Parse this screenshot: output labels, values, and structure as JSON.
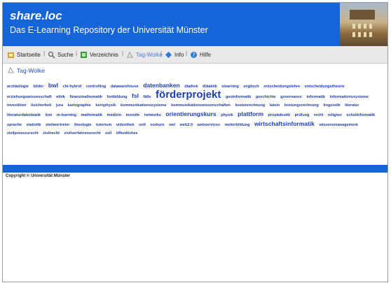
{
  "header": {
    "brand": "share.loc",
    "subtitle": "Das E-Learning Repository der Universität Münster"
  },
  "nav": {
    "items": [
      {
        "label": "Startseite",
        "icon": "home-icon"
      },
      {
        "label": "Suche",
        "icon": "search-icon"
      },
      {
        "label": "Verzeichnis",
        "icon": "directory-icon"
      },
      {
        "label": "Tag-Wolke",
        "icon": "tag-cloud-icon"
      },
      {
        "label": "Info",
        "icon": "info-icon"
      },
      {
        "label": "Hilfe",
        "icon": "help-icon"
      }
    ],
    "separator": "|"
  },
  "breadcrumb": {
    "label": "Tag-Wolke"
  },
  "tags": [
    {
      "label": "archäologie",
      "size": 1
    },
    {
      "label": "bilder",
      "size": 1
    },
    {
      "label": "bwl",
      "size": 3
    },
    {
      "label": "chi-hybrid",
      "size": 1
    },
    {
      "label": "controlling",
      "size": 1
    },
    {
      "label": "datawarehouse",
      "size": 1
    },
    {
      "label": "datenbanken",
      "size": 3
    },
    {
      "label": "diathek",
      "size": 1
    },
    {
      "label": "didaktik",
      "size": 1
    },
    {
      "label": "elearning",
      "size": 1
    },
    {
      "label": "englisch",
      "size": 1
    },
    {
      "label": "entscheidungslehre",
      "size": 1
    },
    {
      "label": "entscheidungstheorie",
      "size": 1
    },
    {
      "label": "erziehungswissenschaft",
      "size": 1
    },
    {
      "label": "ethik",
      "size": 1
    },
    {
      "label": "finanzmathematik",
      "size": 1
    },
    {
      "label": "fortbildung",
      "size": 1
    },
    {
      "label": "fsl",
      "size": 3
    },
    {
      "label": "fälle",
      "size": 1
    },
    {
      "label": "förderprojekt",
      "size": 5
    },
    {
      "label": "geoinformatik",
      "size": 1
    },
    {
      "label": "geschichte",
      "size": 1
    },
    {
      "label": "governance",
      "size": 1
    },
    {
      "label": "informatik",
      "size": 1
    },
    {
      "label": "informationssysteme",
      "size": 1
    },
    {
      "label": "investition",
      "size": 1
    },
    {
      "label": "itsicherheit",
      "size": 1
    },
    {
      "label": "jura",
      "size": 1
    },
    {
      "label": "kartographie",
      "size": 1
    },
    {
      "label": "kernphysik",
      "size": 1
    },
    {
      "label": "kommunikationssysteme",
      "size": 1
    },
    {
      "label": "kommunikationswissenschaften",
      "size": 1
    },
    {
      "label": "kostenrechnung",
      "size": 1
    },
    {
      "label": "latein",
      "size": 1
    },
    {
      "label": "leistungsrechnung",
      "size": 1
    },
    {
      "label": "linguistik",
      "size": 1
    },
    {
      "label": "literatur",
      "size": 1
    },
    {
      "label": "literaturdatenbank",
      "size": 1
    },
    {
      "label": "lom",
      "size": 1
    },
    {
      "label": "m-learning",
      "size": 1
    },
    {
      "label": "mathematik",
      "size": 1
    },
    {
      "label": "medizin",
      "size": 1
    },
    {
      "label": "moodle",
      "size": 1
    },
    {
      "label": "networks",
      "size": 1
    },
    {
      "label": "orientierungskurs",
      "size": 3
    },
    {
      "label": "physik",
      "size": 1
    },
    {
      "label": "plattform",
      "size": 3
    },
    {
      "label": "propädeutik",
      "size": 1
    },
    {
      "label": "prüfung",
      "size": 1
    },
    {
      "label": "recht",
      "size": 1
    },
    {
      "label": "religion",
      "size": 1
    },
    {
      "label": "schulinformatik",
      "size": 1
    },
    {
      "label": "sprache",
      "size": 1
    },
    {
      "label": "statistik",
      "size": 1
    },
    {
      "label": "steilwertreter",
      "size": 1
    },
    {
      "label": "theologie",
      "size": 1
    },
    {
      "label": "tutorium",
      "size": 1
    },
    {
      "label": "videothek",
      "size": 1
    },
    {
      "label": "vofi",
      "size": 1
    },
    {
      "label": "vorkurs",
      "size": 1
    },
    {
      "label": "vwl",
      "size": 1
    },
    {
      "label": "web2.0",
      "size": 1
    },
    {
      "label": "webservices",
      "size": 1
    },
    {
      "label": "weiterbildung",
      "size": 1
    },
    {
      "label": "wirtschaftsinformatik",
      "size": 3
    },
    {
      "label": "wissensmanagement",
      "size": 1
    },
    {
      "label": "zivilprozessrecht",
      "size": 1
    },
    {
      "label": "zivilrecht",
      "size": 1
    },
    {
      "label": "zivilverfahrensrecht",
      "size": 1
    },
    {
      "label": "zoll",
      "size": 1
    },
    {
      "label": "öffentliches",
      "size": 1
    }
  ],
  "footer": {
    "copyright": "Copyright © Universität Münster"
  },
  "colors": {
    "brand_blue": "#1565d8",
    "link_blue": "#1d3fb0"
  }
}
